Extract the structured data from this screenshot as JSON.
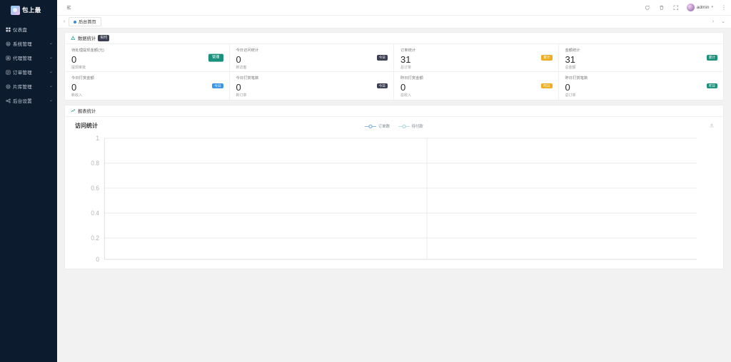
{
  "sidebar": {
    "logo_text": "包上最",
    "items": [
      {
        "label": "仪表盘",
        "icon": "dashboard-icon",
        "has_arrow": false
      },
      {
        "label": "系统管理",
        "icon": "settings-gear-icon",
        "has_arrow": true
      },
      {
        "label": "代理管理",
        "icon": "agent-card-icon",
        "has_arrow": true
      },
      {
        "label": "订单管理",
        "icon": "order-list-icon",
        "has_arrow": true
      },
      {
        "label": "片库管理",
        "icon": "media-library-icon",
        "has_arrow": true
      },
      {
        "label": "后台设置",
        "icon": "share-config-icon",
        "has_arrow": true
      }
    ],
    "arrow_glyph": "⌄"
  },
  "topbar": {
    "collapse_icon": "menu-collapse-icon",
    "actions": [
      {
        "name": "refresh-icon"
      },
      {
        "name": "clear-cache-icon"
      },
      {
        "name": "fullscreen-icon"
      }
    ],
    "user_name": "admin",
    "user_caret": "▾",
    "more_glyph": "⋮"
  },
  "tabbar": {
    "prev_glyph": "‹",
    "next_glyph": "›",
    "dropdown_glyph": "⌄",
    "tabs": [
      {
        "label": "后台首页",
        "active": true
      }
    ]
  },
  "stats_panel": {
    "icon": "warning-triangle-icon",
    "title": "数据统计",
    "badge": "实时",
    "cards": [
      {
        "label": "待处理提现金额(元)",
        "value": "0",
        "sub": "提现审批",
        "action_label": "管理",
        "action_color": "#19917d",
        "badge": null,
        "badge_color": null
      },
      {
        "label": "今日访问统计",
        "value": "0",
        "sub": "新访客",
        "action_label": null,
        "badge": "今日",
        "badge_color": "#3a3f51"
      },
      {
        "label": "订单统计",
        "value": "31",
        "sub": "总订单",
        "action_label": null,
        "badge": "累计",
        "badge_color": "#f0ad20"
      },
      {
        "label": "金额统计",
        "value": "31",
        "sub": "总金额",
        "action_label": null,
        "badge": "累计",
        "badge_color": "#19917d"
      },
      {
        "label": "今日打赏金额",
        "value": "0",
        "sub": "新收入",
        "action_label": null,
        "badge": "今日",
        "badge_color": "#3c96e8"
      },
      {
        "label": "今日打赏笔数",
        "value": "0",
        "sub": "新订单",
        "action_label": null,
        "badge": "今日",
        "badge_color": "#3a3f51"
      },
      {
        "label": "昨日打赏金额",
        "value": "0",
        "sub": "总收入",
        "action_label": null,
        "badge": "昨日",
        "badge_color": "#f0ad20"
      },
      {
        "label": "昨日打赏笔数",
        "value": "0",
        "sub": "总订单",
        "action_label": null,
        "badge": "昨日",
        "badge_color": "#19917d"
      }
    ]
  },
  "report_panel": {
    "icon": "line-chart-icon",
    "title": "报表统计",
    "download_icon": "download-icon"
  },
  "chart_data": {
    "type": "line",
    "title": "访问统计",
    "xlabel": "",
    "ylabel": "",
    "ylim": [
      0,
      1
    ],
    "yticks": [
      "0",
      "0.2",
      "0.4",
      "0.6",
      "0.8",
      "1"
    ],
    "x": [],
    "xticks": [],
    "grid": true,
    "legend_position": "top-center",
    "series": [
      {
        "name": "订单数",
        "color": "#5b9bd5",
        "values": []
      },
      {
        "name": "待付款",
        "color": "#9ad6e0",
        "values": []
      }
    ]
  }
}
